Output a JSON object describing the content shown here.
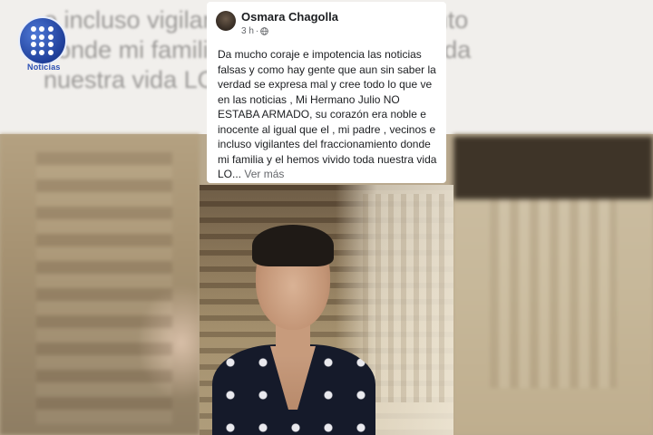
{
  "background": {
    "blurred_text": "o incluso vigilantes del fraccionamiento donde mi familia y el hemos vivido toda nuestra vida LO..."
  },
  "logo": {
    "label": "Noticias"
  },
  "post": {
    "author": "Osmara Chagolla",
    "time": "3 h",
    "separator": "·",
    "body": "Da mucho coraje e impotencia las noticias falsas y como hay gente que aun sin saber la verdad se expresa mal y cree todo lo que ve en las noticias , Mi Hermano Julio NO ESTABA ARMADO, su corazón era noble e inocente al igual que el , mi padre , vecinos e incluso vigilantes del fraccionamiento donde mi familia y el hemos vivido toda nuestra vida LO...",
    "see_more": "Ver más",
    "privacy_icon": "globe-icon"
  },
  "colors": {
    "card_bg": "#ffffff",
    "text_primary": "#1c1e21",
    "text_secondary": "#65676b",
    "logo_blue": "#1f3f9a"
  }
}
